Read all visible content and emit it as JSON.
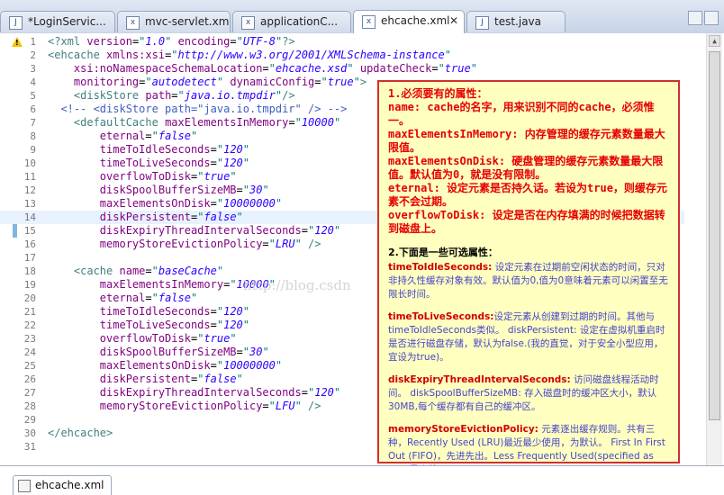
{
  "tabs": [
    {
      "label": "*LoginServic...",
      "icon": "java-file-icon",
      "active": false
    },
    {
      "label": "mvc-servlet.xml",
      "icon": "xml-file-icon",
      "active": false
    },
    {
      "label": "applicationC...",
      "icon": "xml-file-icon",
      "active": false
    },
    {
      "label": "ehcache.xml",
      "icon": "xml-file-icon",
      "active": true
    },
    {
      "label": "test.java",
      "icon": "java-file-icon",
      "active": false
    }
  ],
  "line_numbers": [
    "1",
    "2",
    "3",
    "4",
    "5",
    "6",
    "7",
    "8",
    "9",
    "10",
    "11",
    "12",
    "13",
    "14",
    "15",
    "16",
    "17",
    "18",
    "19",
    "20",
    "21",
    "22",
    "23",
    "24",
    "25",
    "26",
    "27",
    "28",
    "29",
    "30",
    "31"
  ],
  "code": [
    "<?xml version=\"1.0\" encoding=\"UTF-8\"?>",
    "<ehcache xmlns:xsi=\"http://www.w3.org/2001/XMLSchema-instance\"",
    "    xsi:noNamespaceSchemaLocation=\"ehcache.xsd\" updateCheck=\"true\"",
    "    monitoring=\"autodetect\" dynamicConfig=\"true\">",
    "    <diskStore path=\"java.io.tmpdir\"/>",
    "  <!-- <diskStore path=\"java.io.tmpdir\" /> -->",
    "    <defaultCache maxElementsInMemory=\"10000\"",
    "        eternal=\"false\"",
    "        timeToIdleSeconds=\"120\"",
    "        timeToLiveSeconds=\"120\"",
    "        overflowToDisk=\"true\"",
    "        diskSpoolBufferSizeMB=\"30\"",
    "        maxElementsOnDisk=\"10000000\"",
    "        diskPersistent=\"false\"",
    "        diskExpiryThreadIntervalSeconds=\"120\"",
    "        memoryStoreEvictionPolicy=\"LRU\" />",
    "",
    "    <cache name=\"baseCache\"",
    "        maxElementsInMemory=\"10000\"",
    "        eternal=\"false\"",
    "        timeToIdleSeconds=\"120\"",
    "        timeToLiveSeconds=\"120\"",
    "        overflowToDisk=\"true\"",
    "        diskSpoolBufferSizeMB=\"30\"",
    "        maxElementsOnDisk=\"10000000\"",
    "        diskPersistent=\"false\"",
    "        diskExpiryThreadIntervalSeconds=\"120\"",
    "        memoryStoreEvictionPolicy=\"LFU\" />",
    "",
    "</ehcache>",
    ""
  ],
  "watermark": "http://blog.csdn",
  "note": {
    "required_title": "1.必须要有的属性：",
    "required_items": [
      "  name: cache的名字，用来识别不同的cache，必须惟一。",
      "  maxElementsInMemory: 内存管理的缓存元素数量最大限值。",
      " maxElementsOnDisk: 硬盘管理的缓存元素数量最大限值。默认值为0，就是没有限制。",
      " eternal: 设定元素是否持久话。若设为true，则缓存元素不会过期。",
      "  overflowToDisk: 设定是否在内存填满的时候把数据转到磁盘上。"
    ],
    "optional_title": "2.下面是一些可选属性：",
    "sections": [
      {
        "key": "timeToIdleSeconds:",
        "text": " 设定元素在过期前空闲状态的时间，只对非持久性缓存对象有效。默认值为0,值为0意味着元素可以闲置至无限长时间。"
      },
      {
        "key": "timeToLiveSeconds:",
        "text": "设定元素从创建到过期的时间。其他与timeToIdleSeconds类似。 diskPersistent: 设定在虚拟机重启时是否进行磁盘存储，默认为false.(我的直觉，对于安全小型应用，宜设为true)。"
      },
      {
        "key": "diskExpiryThreadIntervalSeconds:",
        "text": " 访问磁盘线程活动时间。 diskSpoolBufferSizeMB: 存入磁盘时的缓冲区大小，默认30MB,每个缓存都有自己的缓冲区。"
      },
      {
        "key": "memoryStoreEvictionPolicy:",
        "text": " 元素逐出缓存规则。共有三种，Recently Used (LRU)最近最少使用，为默认。 First In First Out (FIFO)，先进先出。Less Frequently Used(specified as LFU)最少使用"
      }
    ]
  },
  "bottom_tab": "ehcache.xml",
  "colors": {
    "note_border": "#d03030",
    "note_bg": "#ffffc0",
    "red_text": "#e60000",
    "blue_text": "#4444cc"
  }
}
